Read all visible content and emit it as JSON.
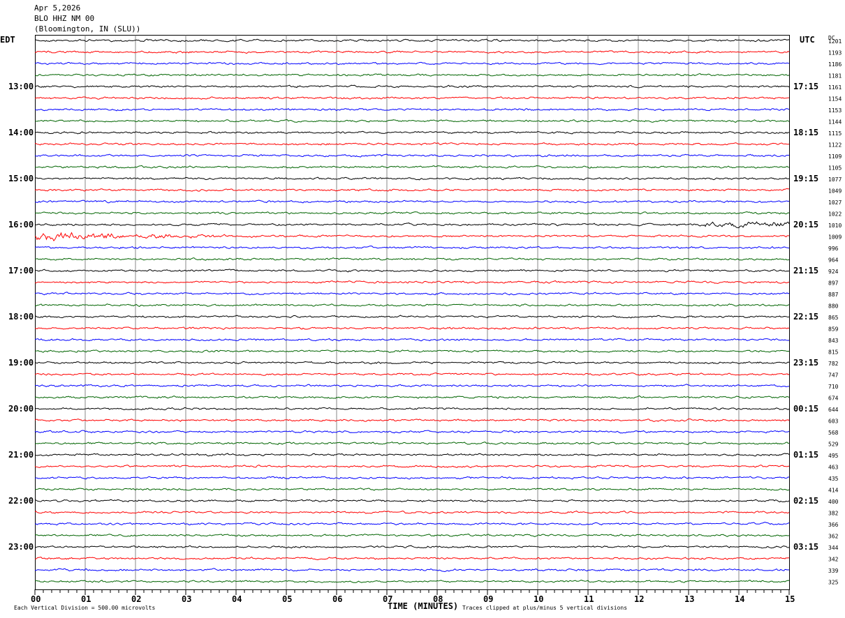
{
  "header": {
    "date": "Apr 5,2026",
    "station": "BLO HHZ NM 00",
    "location": "(Bloomington, IN (SLU))"
  },
  "chart_data": {
    "type": "line",
    "title": "",
    "left_axis_label": "EDT",
    "right_axis_label": "UTC",
    "dc_label": "DC",
    "xlabel": "TIME (MINUTES)",
    "xlim": [
      0,
      15
    ],
    "x_ticks": [
      "00",
      "01",
      "02",
      "03",
      "04",
      "05",
      "06",
      "07",
      "08",
      "09",
      "10",
      "11",
      "12",
      "13",
      "14",
      "15"
    ],
    "grid": true,
    "trace_colors": [
      "#000000",
      "#ff0000",
      "#0000ff",
      "#006400"
    ],
    "left_time_labels": [
      {
        "row": 4,
        "label": "13:00"
      },
      {
        "row": 8,
        "label": "14:00"
      },
      {
        "row": 12,
        "label": "15:00"
      },
      {
        "row": 16,
        "label": "16:00"
      },
      {
        "row": 20,
        "label": "17:00"
      },
      {
        "row": 24,
        "label": "18:00"
      },
      {
        "row": 28,
        "label": "19:00"
      },
      {
        "row": 32,
        "label": "20:00"
      },
      {
        "row": 36,
        "label": "21:00"
      },
      {
        "row": 40,
        "label": "22:00"
      },
      {
        "row": 44,
        "label": "23:00"
      }
    ],
    "right_time_labels": [
      {
        "row": 4,
        "label": "17:15"
      },
      {
        "row": 8,
        "label": "18:15"
      },
      {
        "row": 12,
        "label": "19:15"
      },
      {
        "row": 16,
        "label": "20:15"
      },
      {
        "row": 20,
        "label": "21:15"
      },
      {
        "row": 24,
        "label": "22:15"
      },
      {
        "row": 28,
        "label": "23:15"
      },
      {
        "row": 32,
        "label": "00:15"
      },
      {
        "row": 36,
        "label": "01:15"
      },
      {
        "row": 40,
        "label": "02:15"
      },
      {
        "row": 44,
        "label": "03:15"
      }
    ],
    "dc_values": [
      "1201",
      "1193",
      "1186",
      "1181",
      "1161",
      "1154",
      "1153",
      "1144",
      "1115",
      "1122",
      "1109",
      "1105",
      "1077",
      "1049",
      "1027",
      "1022",
      "1010",
      "1009",
      "996",
      "964",
      "924",
      "897",
      "887",
      "880",
      "865",
      "859",
      "843",
      "815",
      "782",
      "747",
      "710",
      "674",
      "644",
      "603",
      "568",
      "529",
      "495",
      "463",
      "435",
      "414",
      "400",
      "382",
      "366",
      "362",
      "344",
      "342",
      "339",
      "325"
    ],
    "events": [
      {
        "row": 16,
        "start_min": 12.5,
        "end_min": 15,
        "note": "increasing amplitude"
      },
      {
        "row": 17,
        "start_min": 0,
        "end_min": 4,
        "note": "large amplitude decaying"
      }
    ]
  },
  "footer": {
    "scale": "Each Vertical Division =  500.00 microvolts",
    "clip": "Traces clipped at plus/minus 5 vertical divisions"
  }
}
